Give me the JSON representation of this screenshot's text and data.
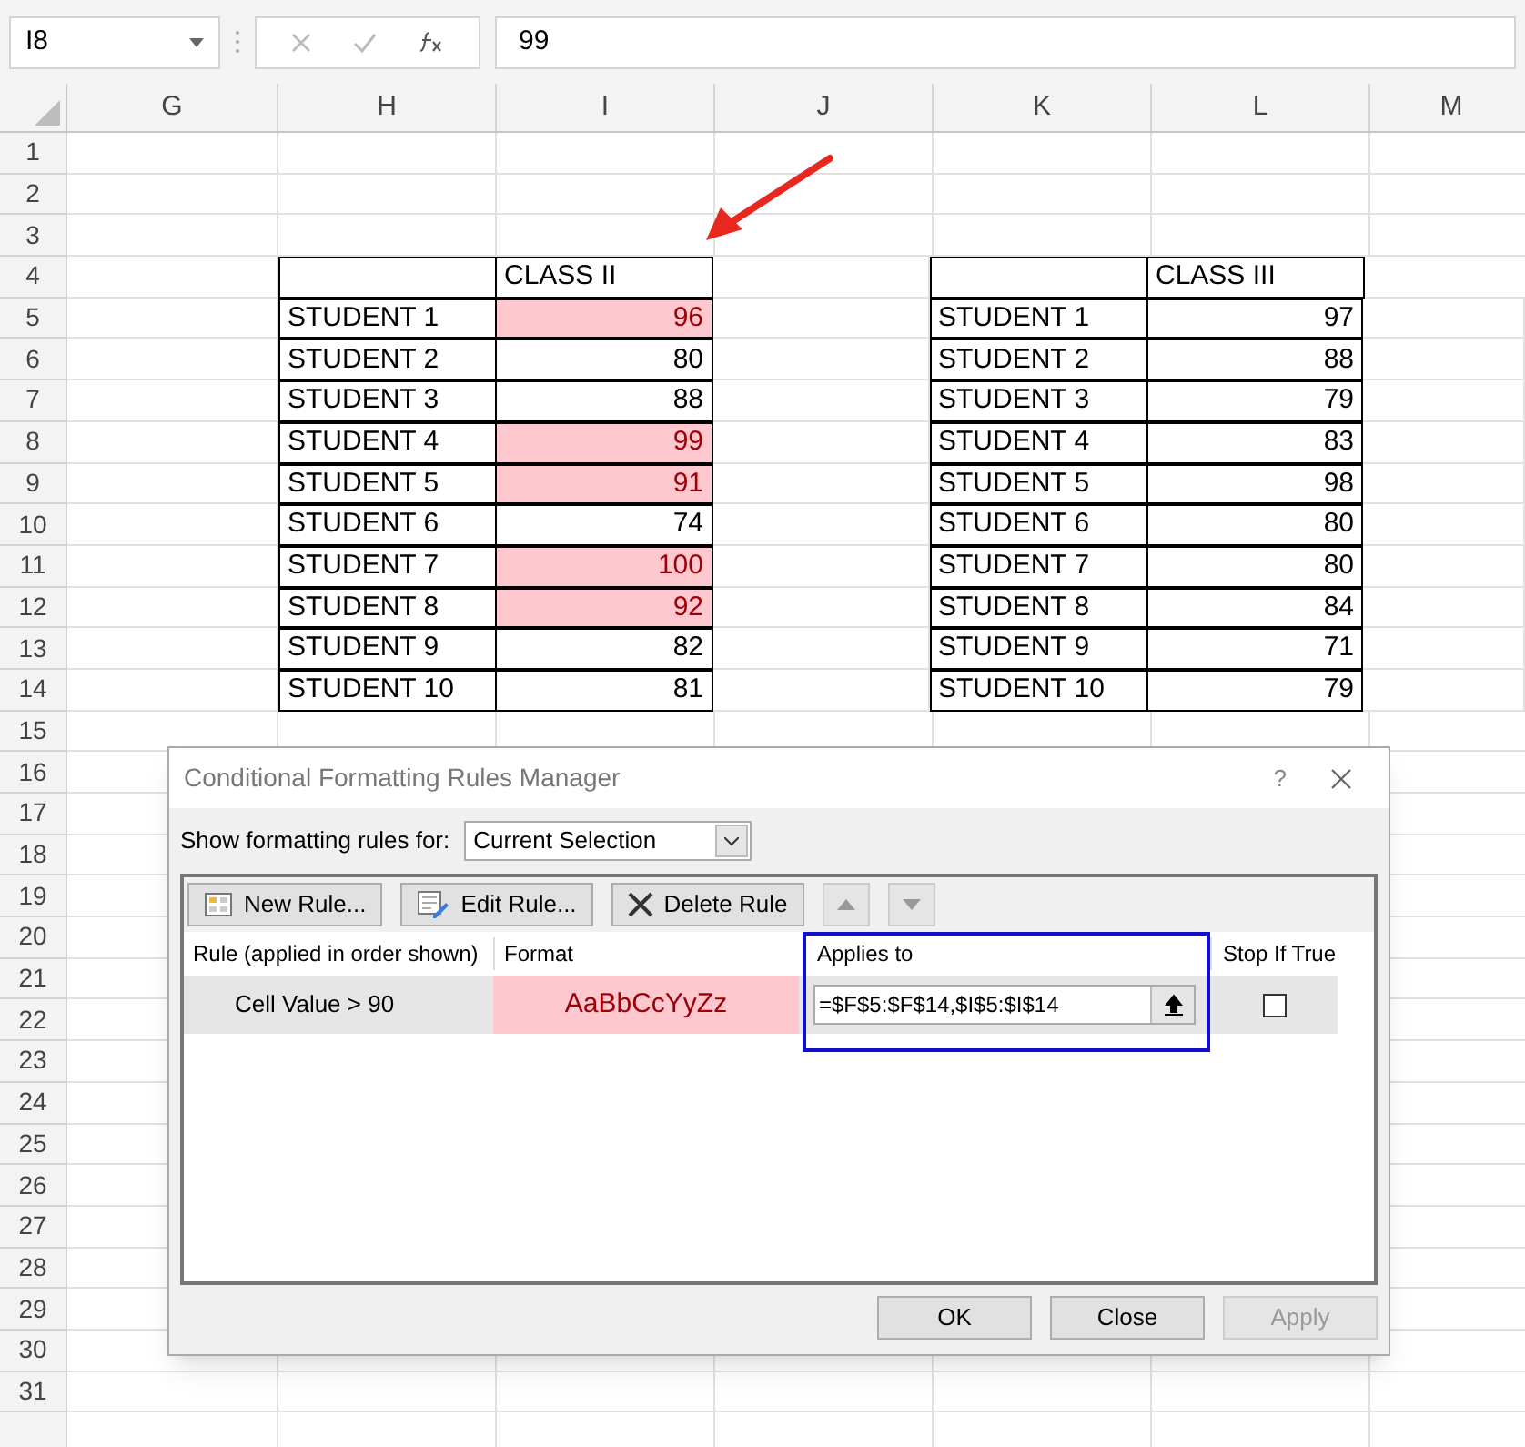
{
  "name_box": {
    "value": "I8"
  },
  "formula_bar": {
    "value": "99"
  },
  "columns": [
    "G",
    "H",
    "I",
    "J",
    "K",
    "L",
    "M"
  ],
  "row_numbers": [
    "1",
    "2",
    "3",
    "4",
    "5",
    "6",
    "7",
    "8",
    "9",
    "10",
    "11",
    "12",
    "13",
    "14",
    "15",
    "16",
    "17",
    "18",
    "19",
    "20",
    "21",
    "22",
    "23",
    "24",
    "25",
    "26",
    "27",
    "28",
    "29",
    "30",
    "31"
  ],
  "tables": [
    {
      "header": "CLASS II",
      "rows": [
        {
          "name": "STUDENT 1",
          "score": "96",
          "highlighted": true
        },
        {
          "name": "STUDENT 2",
          "score": "80",
          "highlighted": false
        },
        {
          "name": "STUDENT 3",
          "score": "88",
          "highlighted": false
        },
        {
          "name": "STUDENT 4",
          "score": "99",
          "highlighted": true
        },
        {
          "name": "STUDENT 5",
          "score": "91",
          "highlighted": true
        },
        {
          "name": "STUDENT 6",
          "score": "74",
          "highlighted": false
        },
        {
          "name": "STUDENT 7",
          "score": "100",
          "highlighted": true
        },
        {
          "name": "STUDENT 8",
          "score": "92",
          "highlighted": true
        },
        {
          "name": "STUDENT 9",
          "score": "82",
          "highlighted": false
        },
        {
          "name": "STUDENT 10",
          "score": "81",
          "highlighted": false
        }
      ]
    },
    {
      "header": "CLASS III",
      "rows": [
        {
          "name": "STUDENT 1",
          "score": "97",
          "highlighted": false
        },
        {
          "name": "STUDENT 2",
          "score": "88",
          "highlighted": false
        },
        {
          "name": "STUDENT 3",
          "score": "79",
          "highlighted": false
        },
        {
          "name": "STUDENT 4",
          "score": "83",
          "highlighted": false
        },
        {
          "name": "STUDENT 5",
          "score": "98",
          "highlighted": false
        },
        {
          "name": "STUDENT 6",
          "score": "80",
          "highlighted": false
        },
        {
          "name": "STUDENT 7",
          "score": "80",
          "highlighted": false
        },
        {
          "name": "STUDENT 8",
          "score": "84",
          "highlighted": false
        },
        {
          "name": "STUDENT 9",
          "score": "71",
          "highlighted": false
        },
        {
          "name": "STUDENT 10",
          "score": "79",
          "highlighted": false
        }
      ]
    }
  ],
  "dialog": {
    "title": "Conditional Formatting Rules Manager",
    "help": "?",
    "show_label": "Show formatting rules for:",
    "show_value": "Current Selection",
    "toolbar": [
      {
        "kind": "new",
        "label": "New Rule..."
      },
      {
        "kind": "edit",
        "label": "Edit Rule..."
      },
      {
        "kind": "delete",
        "label": "Delete Rule"
      },
      {
        "kind": "up"
      },
      {
        "kind": "down"
      }
    ],
    "columns": [
      "Rule (applied in order shown)",
      "Format",
      "Applies to",
      "Stop If True"
    ],
    "rules": [
      {
        "rule": "Cell Value > 90",
        "format_preview": "AaBbCcYyZz",
        "applies_to": "=$F$5:$F$14,$I$5:$I$14",
        "stop_if_true": false,
        "selected": true
      }
    ],
    "buttons": [
      {
        "label": "OK",
        "disabled": false
      },
      {
        "label": "Close",
        "disabled": false
      },
      {
        "label": "Apply",
        "disabled": true
      }
    ]
  }
}
